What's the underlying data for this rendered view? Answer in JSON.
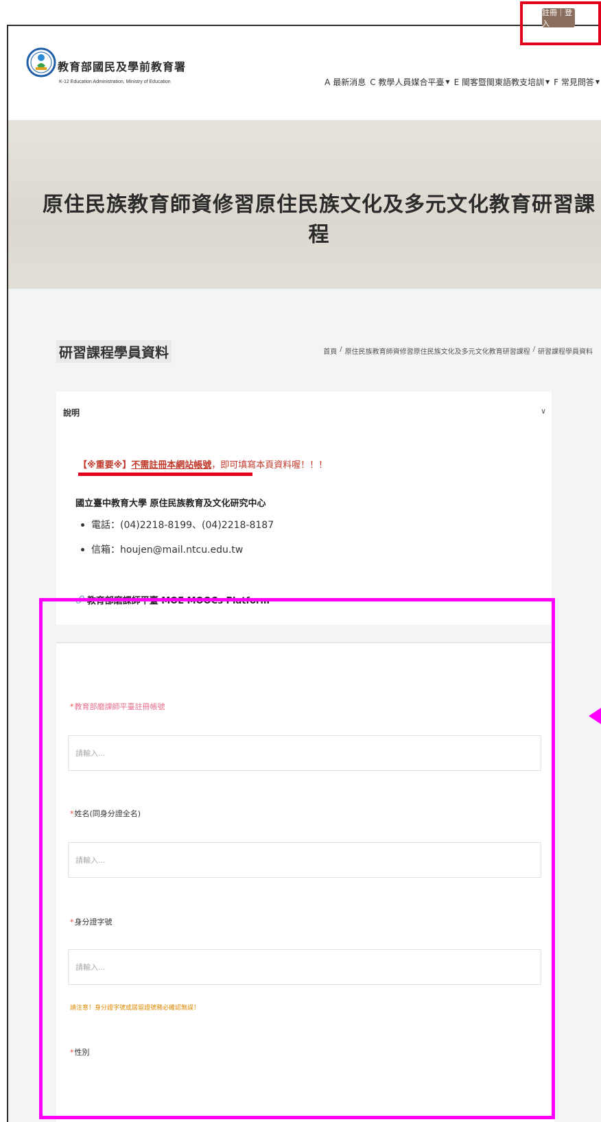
{
  "header": {
    "logo_title": "教育部國民及學前教育署",
    "logo_subtitle": "K-12 Education Administration, Ministry of Education",
    "nav": [
      {
        "label": "A 最新消息",
        "has_caret": false
      },
      {
        "label": "C 教學人員媒合平臺",
        "has_caret": true
      },
      {
        "label": "E 閩客暨閩東語教支培訓",
        "has_caret": true
      },
      {
        "label": "F 常見問答",
        "has_caret": true
      }
    ],
    "login_label": "註冊｜登入"
  },
  "hero": {
    "title": "原住民族教育師資修習原住民族文化及多元文化教育研習課程"
  },
  "page": {
    "heading": "研習課程學員資料",
    "breadcrumb": [
      "首頁",
      "/",
      "原住民族教育師資修習原住民族文化及多元文化教育研習課程",
      "/",
      "研習課程學員資料"
    ]
  },
  "info": {
    "title": "說明",
    "chevron": "∨",
    "notice_important": "【※重要※】",
    "notice_noreg": "不需註冊本網站帳號",
    "notice_rest": "，即可填寫本頁資料喔！！！",
    "org_name": "國立臺中教育大學 原住民族教育及文化研究中心",
    "contacts": [
      "電話：(04)2218-8199、(04)2218-8187",
      "信箱：houjen@mail.ntcu.edu.tw"
    ],
    "link_icon": "🔗",
    "link_label": "教育部磨課師平臺 MOE MOOCs Platform"
  },
  "form": {
    "required_mark": "*",
    "placeholder": "請輸入...",
    "fields": {
      "moocs_account": "教育部磨課師平臺註冊帳號",
      "name": "姓名(同身分證全名)",
      "id_number": "身分證字號",
      "gender": "性別"
    },
    "id_warning": "請注意！身分證字號或居留證號務必確認無誤！"
  },
  "colors": {
    "brand": "#8b6f5e",
    "highlight_red": "#e3001b",
    "highlight_magenta": "#ff00ff"
  }
}
